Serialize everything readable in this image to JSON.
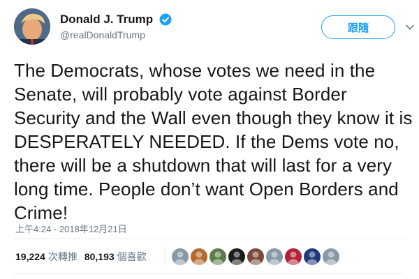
{
  "user": {
    "display_name": "Donald J. Trump",
    "handle": "@realDonaldTrump",
    "avatar_icon": "profile-photo",
    "verified_icon": "verified-badge-icon"
  },
  "follow_button": {
    "label": "跟隨"
  },
  "menu_icon": "chevron-down-icon",
  "tweet": {
    "text": "The Democrats, whose votes we need in the Senate, will probably vote against Border Security and the Wall even though they know it is DESPERATELY NEEDED. If the Dems vote no, there will be a shutdown that will last for a very long time. People don’t want Open Borders and Crime!",
    "timestamp": "上午4:24 - 2018年12月21日"
  },
  "stats": {
    "retweets_count": "19,224",
    "retweets_label": "次轉推",
    "likes_count": "80,193",
    "likes_label": "個喜歡"
  },
  "likers": [
    {
      "name": "liker-avatar-1",
      "color": "#8899a6"
    },
    {
      "name": "liker-avatar-2",
      "color": "#b36a2e"
    },
    {
      "name": "liker-avatar-3",
      "color": "#5a7d4a"
    },
    {
      "name": "liker-avatar-4",
      "color": "#1c1c1c"
    },
    {
      "name": "liker-avatar-5",
      "color": "#7a4b3a"
    },
    {
      "name": "liker-avatar-6",
      "color": "#8899a6"
    },
    {
      "name": "liker-avatar-7",
      "color": "#b22234"
    },
    {
      "name": "liker-avatar-8",
      "color": "#1c3a7a"
    },
    {
      "name": "liker-avatar-9",
      "color": "#8899a6"
    }
  ],
  "colors": {
    "accent": "#1da1f2",
    "text": "#14171a",
    "muted": "#657786",
    "divider": "#e6ecf0"
  }
}
